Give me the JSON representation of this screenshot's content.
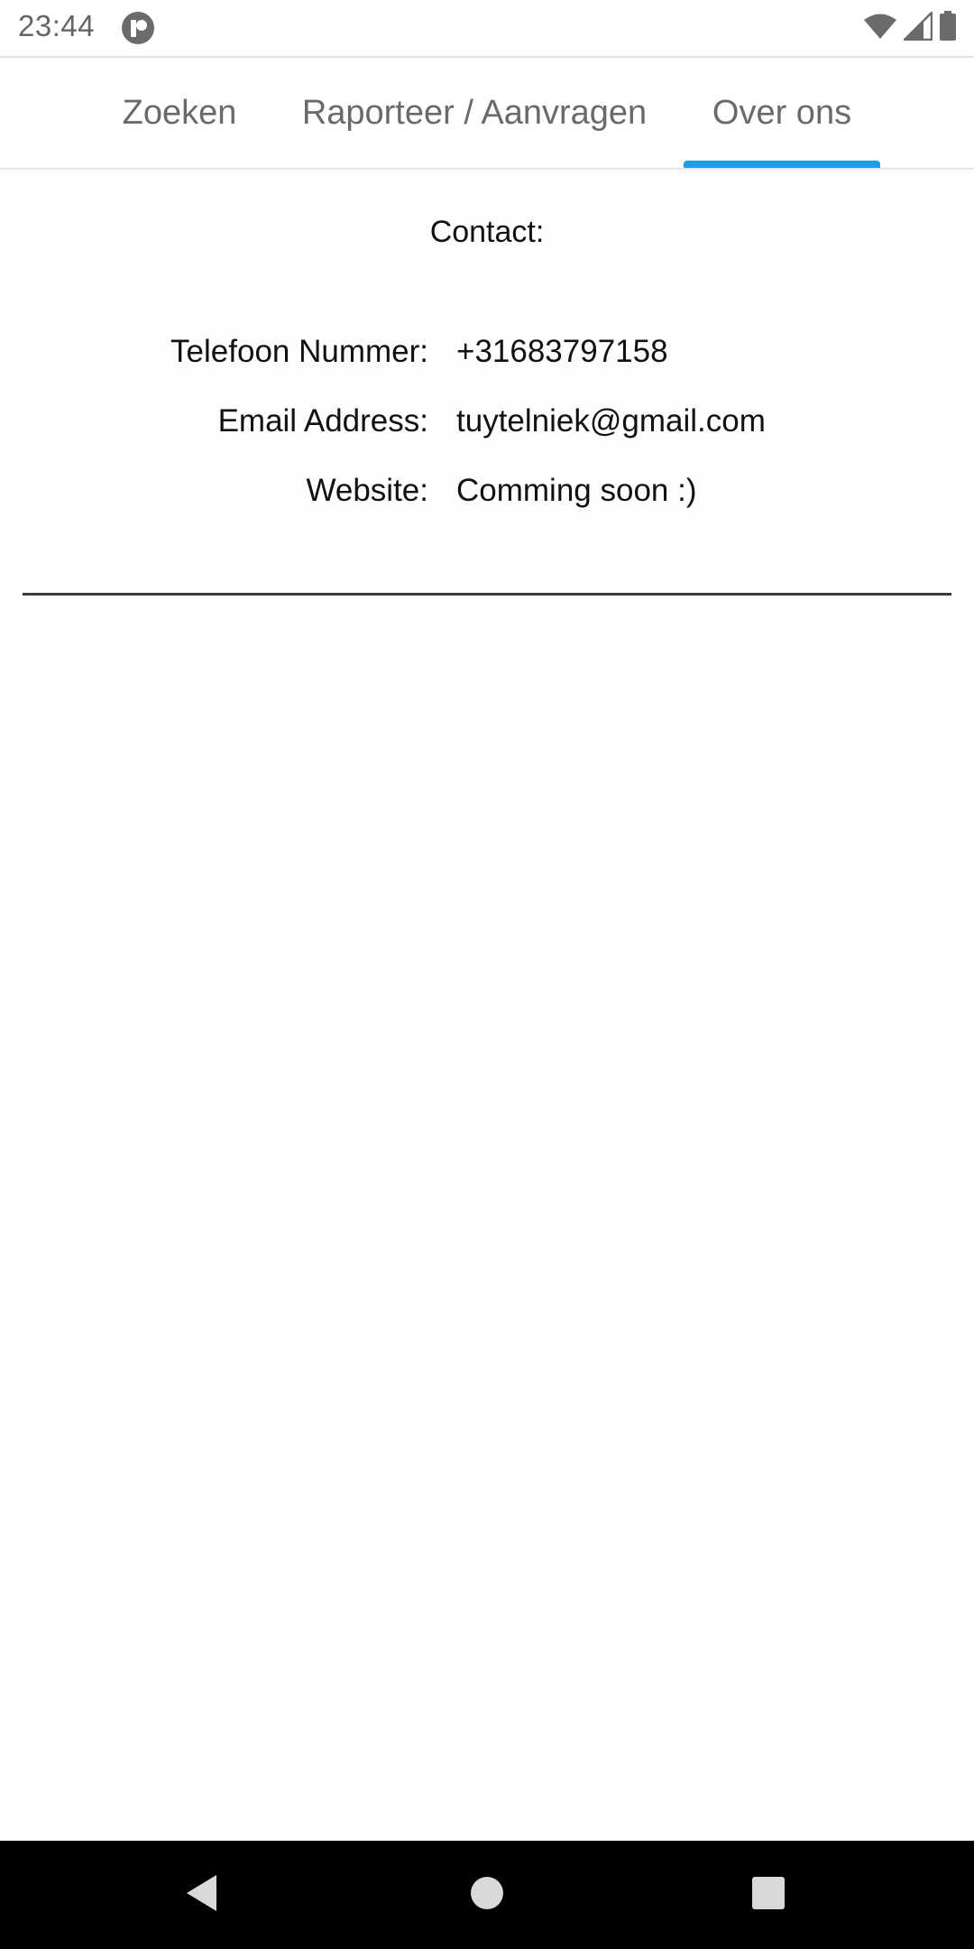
{
  "status_bar": {
    "time": "23:44",
    "icons": [
      "app-notification-icon",
      "wifi-icon",
      "cell-signal-icon",
      "battery-icon"
    ]
  },
  "tabs": [
    {
      "label": "Zoeken",
      "selected": false
    },
    {
      "label": "Raporteer / Aanvragen",
      "selected": false
    },
    {
      "label": "Over ons",
      "selected": true
    }
  ],
  "colors": {
    "accent": "#14a4e6",
    "text": "#111111",
    "tab_text": "#6a6a6a",
    "background": "#fdfdfd",
    "nav_bar": "#000000"
  },
  "contact": {
    "title": "Contact:",
    "rows": [
      {
        "label": "Telefoon Nummer:",
        "value": "+31683797158"
      },
      {
        "label": "Email Address:",
        "value": "tuytelniek@gmail.com"
      },
      {
        "label": "Website:",
        "value": "Comming soon :)"
      }
    ]
  },
  "nav_bar": {
    "buttons": [
      "back-icon",
      "home-icon",
      "recents-icon"
    ]
  }
}
